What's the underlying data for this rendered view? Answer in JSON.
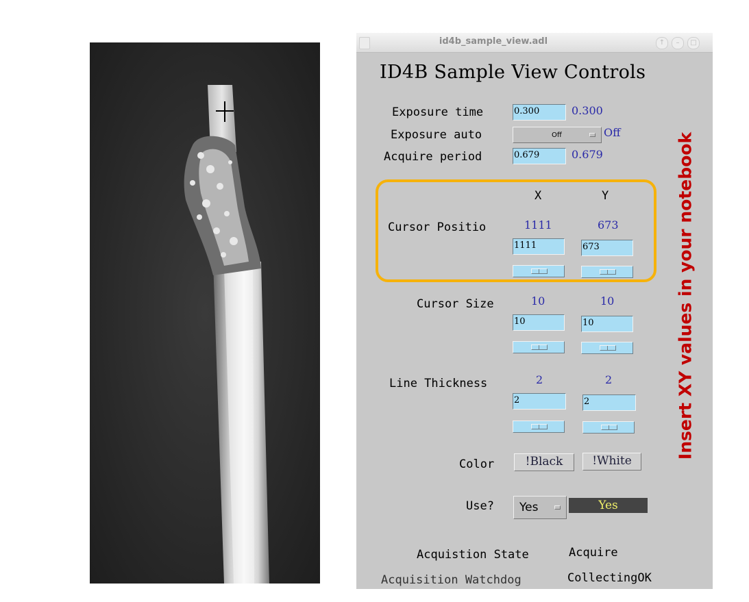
{
  "window": {
    "title": "id4b_sample_view.adl",
    "heading": "ID4B Sample View Controls"
  },
  "exposure": {
    "time_label": "Exposure time",
    "time_input": "0.300",
    "time_readback": "0.300",
    "auto_label": "Exposure auto",
    "auto_menu": "Off",
    "auto_readback": "Off",
    "period_label": "Acquire period",
    "period_input": "0.679",
    "period_readback": "0.679"
  },
  "columns": {
    "x": "X",
    "y": "Y"
  },
  "cursor_position": {
    "label": "Cursor Positio",
    "x_readback": "1111",
    "y_readback": "673",
    "x_input": "1111",
    "y_input": "673"
  },
  "cursor_size": {
    "label": "Cursor Size",
    "x_readback": "10",
    "y_readback": "10",
    "x_input": "10",
    "y_input": "10"
  },
  "line_thickness": {
    "label": "Line Thickness",
    "x_readback": "2",
    "y_readback": "2",
    "x_input": "2",
    "y_input": "2"
  },
  "color": {
    "label": "Color",
    "black_button": "!Black",
    "white_button": "!White"
  },
  "use": {
    "label": "Use?",
    "menu": "Yes",
    "readback": "Yes"
  },
  "status": {
    "acq_state_label": "Acquistion State",
    "acq_state_value": "Acquire",
    "watchdog_label": "Acquisition Watchdog",
    "watchdog_value": "CollectingOK"
  },
  "annotation": {
    "text": "Insert XY values in your notebook",
    "color": "#c00000",
    "highlight_color": "#f6b20b"
  },
  "colors": {
    "panel_bg": "#c8c8c8",
    "input_bg": "#a9ddf4",
    "readback_text": "#2a2aa8",
    "yes_text": "#f0f06a"
  }
}
